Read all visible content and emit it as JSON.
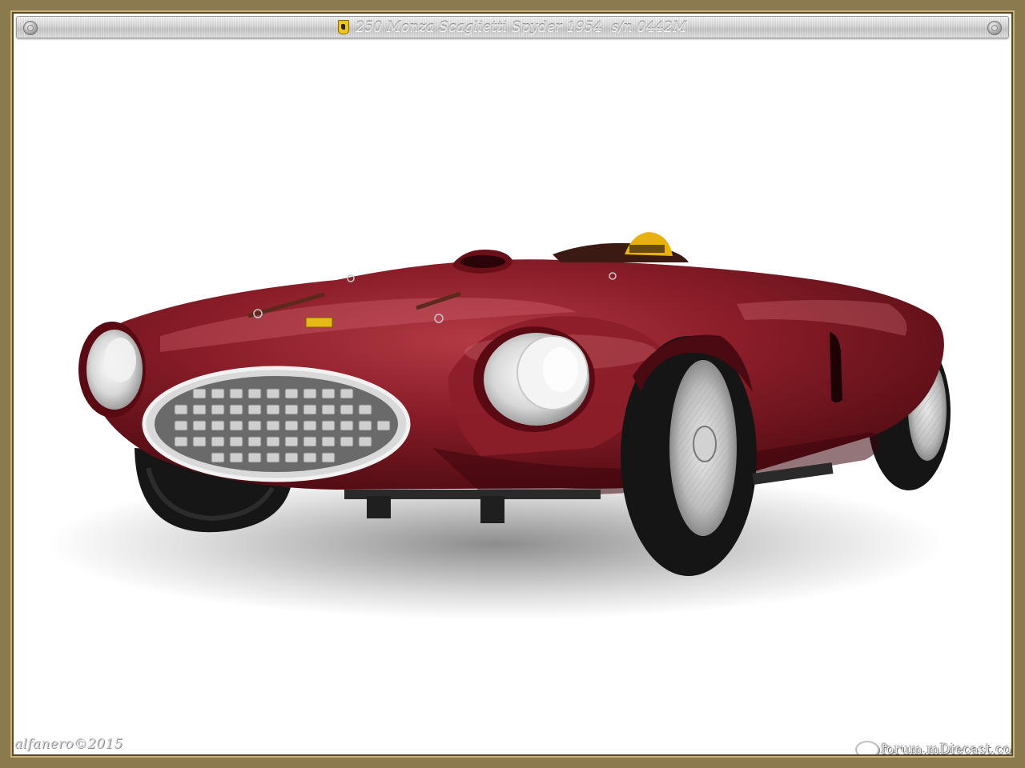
{
  "header": {
    "title": "250 Monza Scaglietti Spyder 1954  s/n 0442M",
    "badge_icon": "prancing-horse-shield-icon"
  },
  "photo": {
    "subject": "",
    "body_color": "#7a1820",
    "background": "#ffffff"
  },
  "watermarks": {
    "author": "alfanero©2015",
    "site": "forum.mDiecast.com"
  },
  "colors": {
    "frame": "#8a7a4e",
    "frame_highlight": "#c9b27a",
    "titlebar": "#d0d0d0"
  }
}
